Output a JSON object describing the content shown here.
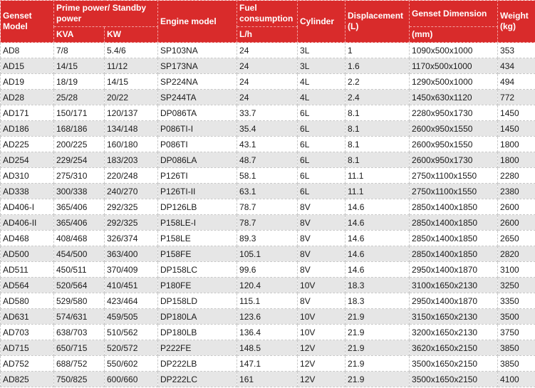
{
  "header": {
    "genset_model": "Genset Model",
    "prime_standby_power": "Prime power/ Standby power",
    "engine_model": "Engine model",
    "fuel_consumption": "Fuel consumption",
    "cylinder": "Cylinder",
    "displacement": "Displacement (L)",
    "genset_dimension": "Genset Dimension",
    "weight": "Weight (kg)",
    "kva": "KVA",
    "kw": "KW",
    "fuel_unit": "L/h",
    "dimension_unit": "(mm)"
  },
  "rows": [
    {
      "model": "AD8",
      "kva": "7/8",
      "kw": "5.4/6",
      "engine": "SP103NA",
      "fuel": "24",
      "cylinder": "3L",
      "displacement": "1",
      "dimension": "1090x500x1000",
      "weight": "353"
    },
    {
      "model": "AD15",
      "kva": "14/15",
      "kw": "11/12",
      "engine": "SP173NA",
      "fuel": "24",
      "cylinder": "3L",
      "displacement": "1.6",
      "dimension": "1170x500x1000",
      "weight": "434"
    },
    {
      "model": "AD19",
      "kva": "18/19",
      "kw": "14/15",
      "engine": "SP224NA",
      "fuel": "24",
      "cylinder": "4L",
      "displacement": "2.2",
      "dimension": "1290x500x1000",
      "weight": "494"
    },
    {
      "model": "AD28",
      "kva": "25/28",
      "kw": "20/22",
      "engine": "SP244TA",
      "fuel": "24",
      "cylinder": "4L",
      "displacement": "2.4",
      "dimension": "1450x630x1120",
      "weight": "772"
    },
    {
      "model": "AD171",
      "kva": "150/171",
      "kw": "120/137",
      "engine": "DP086TA",
      "fuel": "33.7",
      "cylinder": "6L",
      "displacement": "8.1",
      "dimension": "2280x950x1730",
      "weight": "1450"
    },
    {
      "model": "AD186",
      "kva": "168/186",
      "kw": "134/148",
      "engine": "P086TI-I",
      "fuel": "35.4",
      "cylinder": "6L",
      "displacement": "8.1",
      "dimension": "2600x950x1550",
      "weight": "1450"
    },
    {
      "model": "AD225",
      "kva": "200/225",
      "kw": "160/180",
      "engine": "P086TI",
      "fuel": "43.1",
      "cylinder": "6L",
      "displacement": "8.1",
      "dimension": "2600x950x1550",
      "weight": "1800"
    },
    {
      "model": "AD254",
      "kva": "229/254",
      "kw": "183/203",
      "engine": "DP086LA",
      "fuel": "48.7",
      "cylinder": "6L",
      "displacement": "8.1",
      "dimension": "2600x950x1730",
      "weight": "1800"
    },
    {
      "model": "AD310",
      "kva": "275/310",
      "kw": "220/248",
      "engine": "P126TI",
      "fuel": "58.1",
      "cylinder": "6L",
      "displacement": "11.1",
      "dimension": "2750x1100x1550",
      "weight": "2280"
    },
    {
      "model": "AD338",
      "kva": "300/338",
      "kw": "240/270",
      "engine": "P126TI-II",
      "fuel": "63.1",
      "cylinder": "6L",
      "displacement": "11.1",
      "dimension": "2750x1100x1550",
      "weight": "2380"
    },
    {
      "model": "AD406-I",
      "kva": "365/406",
      "kw": "292/325",
      "engine": "DP126LB",
      "fuel": "78.7",
      "cylinder": "8V",
      "displacement": "14.6",
      "dimension": "2850x1400x1850",
      "weight": "2600"
    },
    {
      "model": "AD406-II",
      "kva": "365/406",
      "kw": "292/325",
      "engine": "P158LE-I",
      "fuel": "78.7",
      "cylinder": "8V",
      "displacement": "14.6",
      "dimension": "2850x1400x1850",
      "weight": "2600"
    },
    {
      "model": "AD468",
      "kva": "408/468",
      "kw": "326/374",
      "engine": "P158LE",
      "fuel": "89.3",
      "cylinder": "8V",
      "displacement": "14.6",
      "dimension": "2850x1400x1850",
      "weight": "2650"
    },
    {
      "model": "AD500",
      "kva": "454/500",
      "kw": "363/400",
      "engine": "P158FE",
      "fuel": "105.1",
      "cylinder": "8V",
      "displacement": "14.6",
      "dimension": "2850x1400x1850",
      "weight": "2820"
    },
    {
      "model": "AD511",
      "kva": "450/511",
      "kw": "370/409",
      "engine": "DP158LC",
      "fuel": "99.6",
      "cylinder": "8V",
      "displacement": "14.6",
      "dimension": "2950x1400x1870",
      "weight": "3100"
    },
    {
      "model": "AD564",
      "kva": "520/564",
      "kw": "410/451",
      "engine": "P180FE",
      "fuel": "120.4",
      "cylinder": "10V",
      "displacement": "18.3",
      "dimension": "3100x1650x2130",
      "weight": "3250"
    },
    {
      "model": "AD580",
      "kva": "529/580",
      "kw": "423/464",
      "engine": "DP158LD",
      "fuel": "115.1",
      "cylinder": "8V",
      "displacement": "18.3",
      "dimension": "2950x1400x1870",
      "weight": "3350"
    },
    {
      "model": "AD631",
      "kva": "574/631",
      "kw": "459/505",
      "engine": "DP180LA",
      "fuel": "123.6",
      "cylinder": "10V",
      "displacement": "21.9",
      "dimension": "3150x1650x2130",
      "weight": "3500"
    },
    {
      "model": "AD703",
      "kva": "638/703",
      "kw": "510/562",
      "engine": "DP180LB",
      "fuel": "136.4",
      "cylinder": "10V",
      "displacement": "21.9",
      "dimension": "3200x1650x2130",
      "weight": "3750"
    },
    {
      "model": "AD715",
      "kva": "650/715",
      "kw": "520/572",
      "engine": "P222FE",
      "fuel": "148.5",
      "cylinder": "12V",
      "displacement": "21.9",
      "dimension": "3620x1650x2150",
      "weight": "3850"
    },
    {
      "model": "AD752",
      "kva": "688/752",
      "kw": "550/602",
      "engine": "DP222LB",
      "fuel": "147.1",
      "cylinder": "12V",
      "displacement": "21.9",
      "dimension": "3500x1650x2150",
      "weight": "3850"
    },
    {
      "model": "AD825",
      "kva": "750/825",
      "kw": "600/660",
      "engine": "DP222LC",
      "fuel": "161",
      "cylinder": "12V",
      "displacement": "21.9",
      "dimension": "3500x1650x2150",
      "weight": "4100"
    }
  ]
}
